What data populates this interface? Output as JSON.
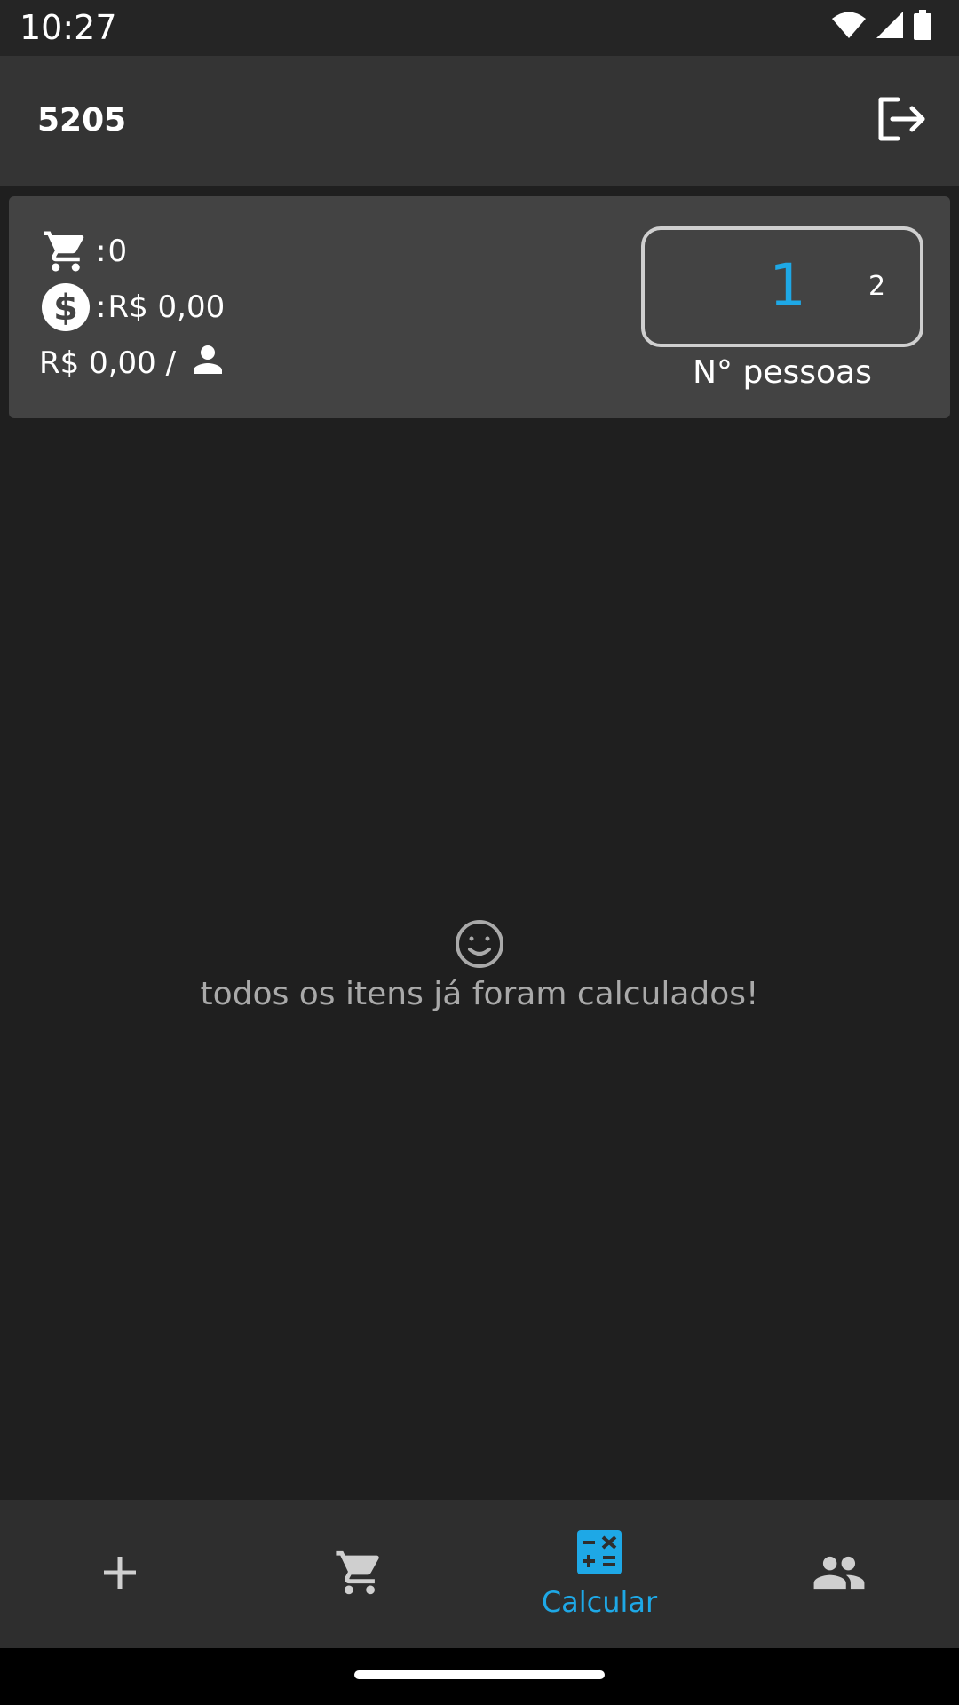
{
  "status_bar": {
    "time": "10:27",
    "icons": [
      "wifi-icon",
      "signal-icon",
      "battery-icon"
    ]
  },
  "app_bar": {
    "title": "5205",
    "logout_icon": "logout-icon"
  },
  "summary": {
    "items_count": "0",
    "total": "R$ 0,00",
    "per_person": "R$ 0,00 /",
    "colon": ":",
    "icons": [
      "cart-icon",
      "dollar-icon",
      "person-icon"
    ]
  },
  "people": {
    "selected": "1",
    "next": "2",
    "label": "N° pessoas"
  },
  "empty_state": {
    "icon": "smiley-icon",
    "message": "todos os itens já foram calculados!"
  },
  "bottom_nav": {
    "items": [
      {
        "icon": "plus-icon",
        "label": "",
        "active": false
      },
      {
        "icon": "cart-icon",
        "label": "",
        "active": false
      },
      {
        "icon": "calculator-icon",
        "label": "Calcular",
        "active": true
      },
      {
        "icon": "group-icon",
        "label": "",
        "active": false
      }
    ]
  },
  "colors": {
    "accent": "#1ea8e6",
    "background": "#1f1f1f",
    "app_bar": "#343434",
    "card": "#434343",
    "bottom_nav": "#2e2e2e"
  }
}
